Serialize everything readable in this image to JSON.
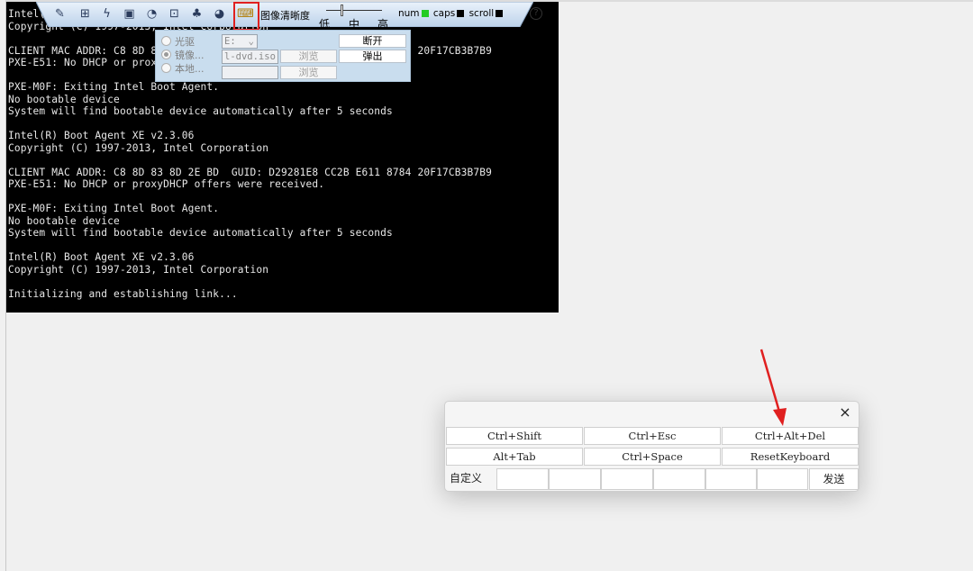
{
  "console": {
    "lines": [
      "Intel(R) Boot Agent XE v2.3.06",
      "Copyright (C) 1997-2013, Intel Corporation",
      "",
      "CLIENT MAC ADDR: C8 8D 83 8D 2E BD  GUID: D29281E8 CC2B E611 8784 20F17CB3B7B9",
      "PXE-E51: No DHCP or proxyDHCP offers were received.",
      "",
      "PXE-M0F: Exiting Intel Boot Agent.",
      "No bootable device",
      "System will find bootable device automatically after 5 seconds",
      "",
      "Intel(R) Boot Agent XE v2.3.06",
      "Copyright (C) 1997-2013, Intel Corporation",
      "",
      "CLIENT MAC ADDR: C8 8D 83 8D 2E BD  GUID: D29281E8 CC2B E611 8784 20F17CB3B7B9",
      "PXE-E51: No DHCP or proxyDHCP offers were received.",
      "",
      "PXE-M0F: Exiting Intel Boot Agent.",
      "No bootable device",
      "System will find bootable device automatically after 5 seconds",
      "",
      "Intel(R) Boot Agent XE v2.3.06",
      "Copyright (C) 1997-2013, Intel Corporation",
      "",
      "Initializing and establishing link..."
    ]
  },
  "toolbar": {
    "image_clarity_label": "图像清晰度",
    "slider_low": "低",
    "slider_mid": "中",
    "slider_high": "高",
    "num_label": "num",
    "caps_label": "caps",
    "scroll_label": "scroll",
    "help_glyph": "?",
    "num_color": "#22cc22",
    "caps_color": "#000000",
    "scroll_color": "#000000"
  },
  "media_panel": {
    "cdrom_label": "光驱",
    "image_label": "镜像...",
    "local_label": "本地...",
    "drive_value": "E:",
    "iso_value": "l-dvd.iso",
    "browse_label": "浏览",
    "browse2_label": "浏览",
    "disconnect_label": "断开",
    "eject_label": "弹出"
  },
  "keyboard_popup": {
    "close_glyph": "×",
    "row1": [
      "Ctrl+Shift",
      "Ctrl+Esc",
      "Ctrl+Alt+Del"
    ],
    "row2": [
      "Alt+Tab",
      "Ctrl+Space",
      "ResetKeyboard"
    ],
    "custom_label": "自定义",
    "send_label": "发送"
  },
  "annotation": {
    "highlight_color": "#e02020"
  }
}
